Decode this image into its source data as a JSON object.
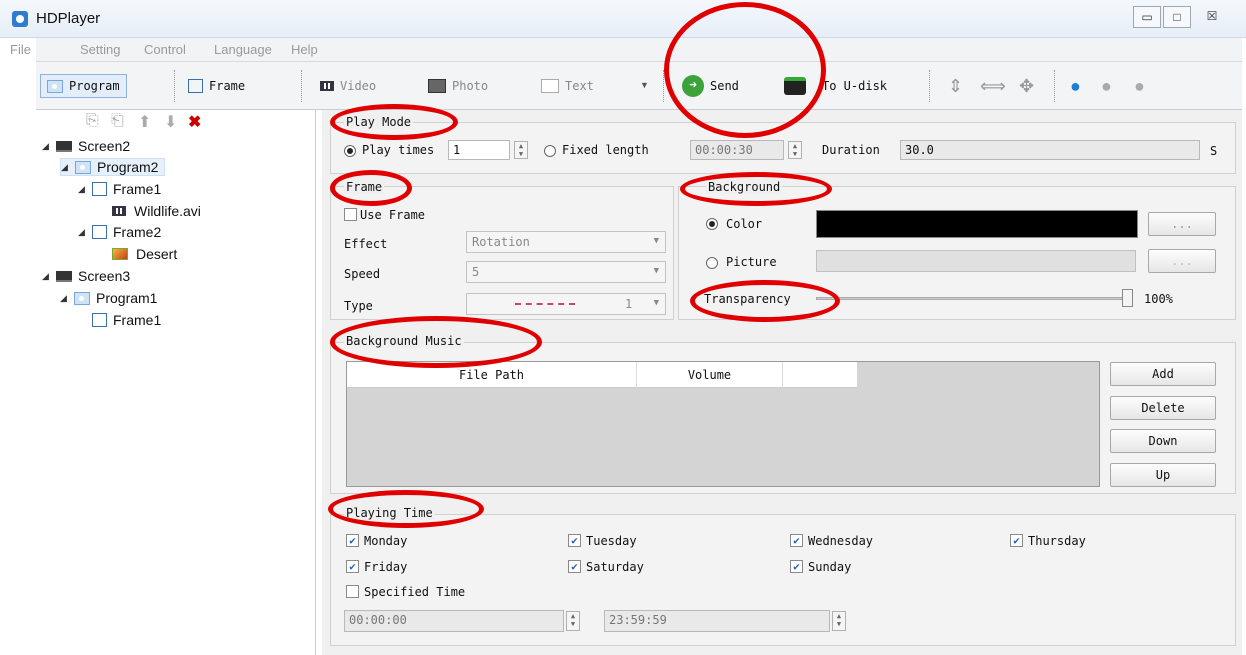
{
  "window": {
    "title": "HDPlayer",
    "min": "▭",
    "max": "□",
    "close": "☒"
  },
  "menu": [
    "File",
    "Setting",
    "Control",
    "Language",
    "Help"
  ],
  "toolbar": {
    "program": "Program",
    "frame": "Frame",
    "video": "Video",
    "photo": "Photo",
    "text": "Text",
    "send": "Send",
    "to_udisk": "To U-disk"
  },
  "tree": [
    {
      "label": "Screen2",
      "type": "screen"
    },
    {
      "label": "Program2",
      "type": "program"
    },
    {
      "label": "Frame1",
      "type": "frame"
    },
    {
      "label": "Wildlife.avi",
      "type": "video"
    },
    {
      "label": "Frame2",
      "type": "frame"
    },
    {
      "label": "Desert",
      "type": "photo"
    },
    {
      "label": "Screen3",
      "type": "screen"
    },
    {
      "label": "Program1",
      "type": "program"
    },
    {
      "label": "Frame1",
      "type": "frame"
    }
  ],
  "play_mode": {
    "title": "Play Mode",
    "play_times_label": "Play times",
    "play_times_value": "1",
    "fixed_length_label": "Fixed length",
    "fixed_length_value": "00:00:30",
    "duration_label": "Duration",
    "duration_value": "30.0",
    "duration_unit": "S"
  },
  "frame_group": {
    "title": "Frame",
    "use_frame": "Use Frame",
    "effect_label": "Effect",
    "effect_value": "Rotation",
    "speed_label": "Speed",
    "speed_value": "5",
    "type_label": "Type",
    "type_value": "1"
  },
  "background": {
    "title": "Background",
    "color_label": "Color",
    "picture_label": "Picture",
    "browse": "...",
    "transparency_label": "Transparency",
    "transparency_value": "100%",
    "color_value": "#000000"
  },
  "music": {
    "title": "Background Music",
    "col_path": "File Path",
    "col_volume": "Volume",
    "add": "Add",
    "delete": "Delete",
    "down": "Down",
    "up": "Up"
  },
  "playing_time": {
    "title": "Playing Time",
    "days": [
      "Monday",
      "Tuesday",
      "Wednesday",
      "Thursday",
      "Friday",
      "Saturday",
      "Sunday"
    ],
    "specified": "Specified Time",
    "start": "00:00:00",
    "end": "23:59:59"
  }
}
